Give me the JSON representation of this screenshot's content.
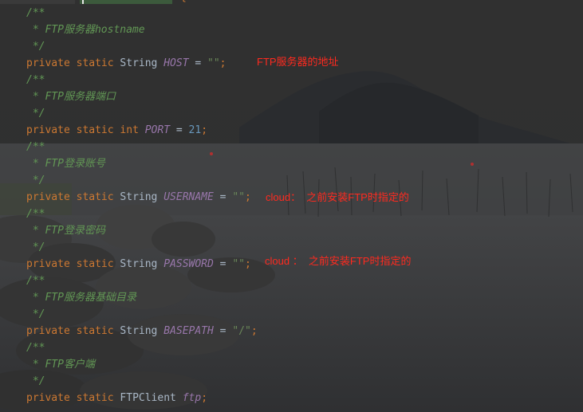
{
  "code_lines": [
    {
      "id": "l1",
      "parts": [
        {
          "t": "/**",
          "c": "c-doc"
        }
      ]
    },
    {
      "id": "l2",
      "parts": [
        {
          "t": " * FTP服务器hostname",
          "c": "c-doc"
        }
      ]
    },
    {
      "id": "l3",
      "parts": [
        {
          "t": " */",
          "c": "c-doc"
        }
      ]
    },
    {
      "id": "l4",
      "parts": [
        {
          "t": "private ",
          "c": "kw"
        },
        {
          "t": "static ",
          "c": "kw"
        },
        {
          "t": "String ",
          "c": "type"
        },
        {
          "t": "HOST",
          "c": "field"
        },
        {
          "t": " = ",
          "c": "punc"
        },
        {
          "t": "\"\"",
          "c": "str"
        },
        {
          "t": ";",
          "c": "kw"
        }
      ]
    },
    {
      "id": "l5",
      "parts": [
        {
          "t": "/**",
          "c": "c-doc"
        }
      ]
    },
    {
      "id": "l6",
      "parts": [
        {
          "t": " * FTP服务器端口",
          "c": "c-doc"
        }
      ]
    },
    {
      "id": "l7",
      "parts": [
        {
          "t": " */",
          "c": "c-doc"
        }
      ]
    },
    {
      "id": "l8",
      "parts": [
        {
          "t": "private ",
          "c": "kw"
        },
        {
          "t": "static ",
          "c": "kw"
        },
        {
          "t": "int ",
          "c": "kw"
        },
        {
          "t": "PORT",
          "c": "field"
        },
        {
          "t": " = ",
          "c": "punc"
        },
        {
          "t": "21",
          "c": "num"
        },
        {
          "t": ";",
          "c": "kw"
        }
      ]
    },
    {
      "id": "l9",
      "parts": [
        {
          "t": "/**",
          "c": "c-doc"
        }
      ]
    },
    {
      "id": "l10",
      "parts": [
        {
          "t": " * FTP登录账号",
          "c": "c-doc"
        }
      ]
    },
    {
      "id": "l11",
      "parts": [
        {
          "t": " */",
          "c": "c-doc"
        }
      ]
    },
    {
      "id": "l12",
      "parts": [
        {
          "t": "private ",
          "c": "kw"
        },
        {
          "t": "static ",
          "c": "kw"
        },
        {
          "t": "String ",
          "c": "type"
        },
        {
          "t": "USERNAME",
          "c": "field"
        },
        {
          "t": " = ",
          "c": "punc"
        },
        {
          "t": "\"\"",
          "c": "str"
        },
        {
          "t": ";",
          "c": "kw"
        }
      ]
    },
    {
      "id": "l13",
      "parts": [
        {
          "t": "/**",
          "c": "c-doc"
        }
      ]
    },
    {
      "id": "l14",
      "parts": [
        {
          "t": " * FTP登录密码",
          "c": "c-doc"
        }
      ]
    },
    {
      "id": "l15",
      "parts": [
        {
          "t": " */",
          "c": "c-doc"
        }
      ]
    },
    {
      "id": "l16",
      "parts": [
        {
          "t": "private ",
          "c": "kw"
        },
        {
          "t": "static ",
          "c": "kw"
        },
        {
          "t": "String ",
          "c": "type"
        },
        {
          "t": "PASSWORD",
          "c": "field"
        },
        {
          "t": " = ",
          "c": "punc"
        },
        {
          "t": "\"\"",
          "c": "str"
        },
        {
          "t": ";",
          "c": "kw"
        }
      ]
    },
    {
      "id": "l17",
      "parts": [
        {
          "t": "/**",
          "c": "c-doc"
        }
      ]
    },
    {
      "id": "l18",
      "parts": [
        {
          "t": " * FTP服务器基础目录",
          "c": "c-doc"
        }
      ]
    },
    {
      "id": "l19",
      "parts": [
        {
          "t": " */",
          "c": "c-doc"
        }
      ]
    },
    {
      "id": "l20",
      "parts": [
        {
          "t": "private ",
          "c": "kw"
        },
        {
          "t": "static ",
          "c": "kw"
        },
        {
          "t": "String ",
          "c": "type"
        },
        {
          "t": "BASEPATH",
          "c": "field"
        },
        {
          "t": " = ",
          "c": "punc"
        },
        {
          "t": "\"/\"",
          "c": "str"
        },
        {
          "t": ";",
          "c": "kw"
        }
      ]
    },
    {
      "id": "l21",
      "parts": [
        {
          "t": "/**",
          "c": "c-doc"
        }
      ]
    },
    {
      "id": "l22",
      "parts": [
        {
          "t": " * FTP客户端",
          "c": "c-doc"
        }
      ]
    },
    {
      "id": "l23",
      "parts": [
        {
          "t": " */",
          "c": "c-doc"
        }
      ]
    },
    {
      "id": "l24",
      "parts": [
        {
          "t": "private ",
          "c": "kw"
        },
        {
          "t": "static ",
          "c": "kw"
        },
        {
          "t": "FTPClient ",
          "c": "type"
        },
        {
          "t": "ftp",
          "c": "field"
        },
        {
          "t": ";",
          "c": "kw"
        }
      ]
    }
  ],
  "annotations": {
    "host_note": "FTP服务器的地址",
    "username_note": "cloud：  之前安装FTP时指定的",
    "password_note": "cloud ：  之前安装FTP时指定的"
  },
  "top_fragment": {
    "brace": "{"
  },
  "colors": {
    "comment": "#629755",
    "keyword": "#cc7832",
    "field": "#9876aa",
    "string": "#6a8759",
    "number": "#6897bb",
    "annotation": "#ff2a1f"
  }
}
